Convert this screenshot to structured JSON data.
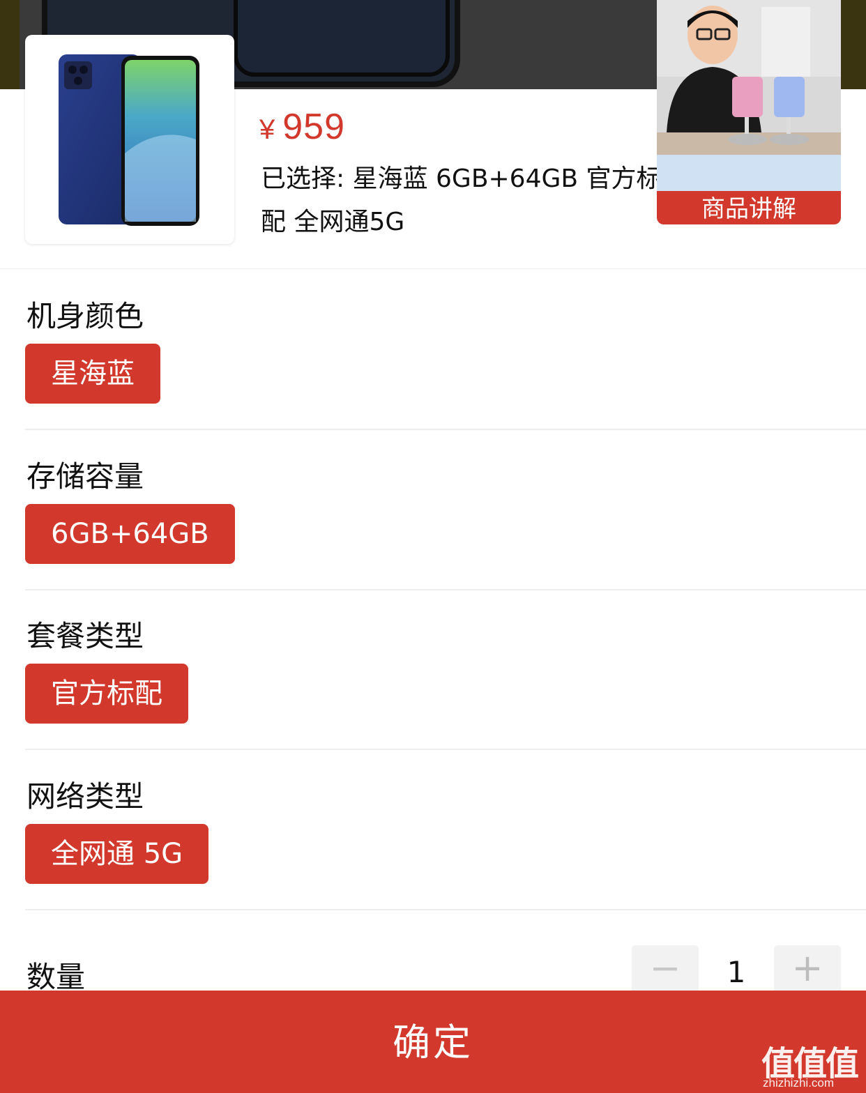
{
  "product": {
    "price_symbol": "¥",
    "price": "959",
    "selected_text": "已选择: 星海蓝 6GB+64GB 官方标配 全网通5G",
    "thumbnail_icon": "phone-product-image"
  },
  "live": {
    "label": "商品讲解"
  },
  "options": {
    "color": {
      "title": "机身颜色",
      "selected": "星海蓝"
    },
    "storage": {
      "title": "存储容量",
      "selected": "6GB+64GB"
    },
    "package": {
      "title": "套餐类型",
      "selected": "官方标配"
    },
    "network": {
      "title": "网络类型",
      "selected": "全网通 5G"
    }
  },
  "quantity": {
    "title": "数量",
    "value": "1",
    "minus": "−",
    "plus": "+"
  },
  "confirm_label": "确定",
  "watermark": {
    "text": "值值值",
    "url": "zhizhizhi.com"
  },
  "colors": {
    "accent": "#d2392c",
    "divider": "#eeeeee",
    "stepper_bg": "#f2f2f2"
  }
}
